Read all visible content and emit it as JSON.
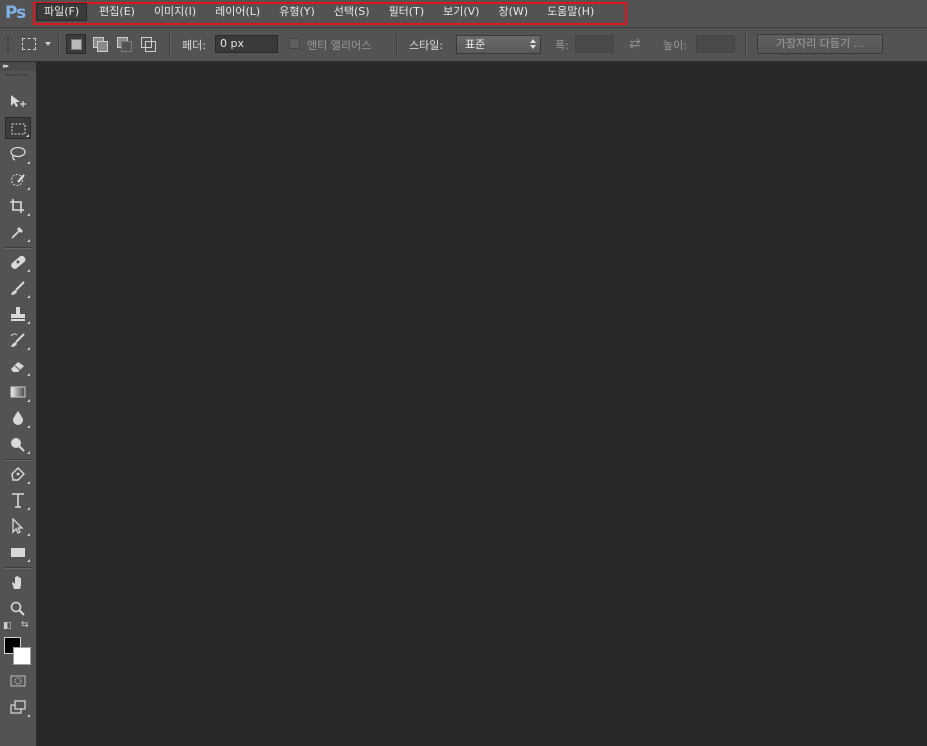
{
  "app": {
    "logo_text": "Ps"
  },
  "menu": {
    "items": [
      {
        "label": "파일(F)",
        "active": true
      },
      {
        "label": "편집(E)"
      },
      {
        "label": "이미지(I)"
      },
      {
        "label": "레이어(L)"
      },
      {
        "label": "유형(Y)"
      },
      {
        "label": "선택(S)"
      },
      {
        "label": "필터(T)"
      },
      {
        "label": "보기(V)"
      },
      {
        "label": "창(W)"
      },
      {
        "label": "도움말(H)"
      }
    ],
    "highlight_color": "#e0141c"
  },
  "options": {
    "feather_label": "페더:",
    "feather_value": "0 px",
    "antialias_label": "앤티 앨리어스",
    "style_label": "스타일:",
    "style_value": "표준",
    "width_label": "폭:",
    "height_label": "높이:",
    "refine_edge_label": "가장자리 다듬기 ..."
  },
  "toolbox": {
    "collapse_glyph": "▸▸",
    "selected_tool": "rectangular-marquee",
    "tools": [
      "move",
      "rectangular-marquee",
      "lasso",
      "quick-selection",
      "crop",
      "eyedropper",
      "spot-healing-brush",
      "brush",
      "clone-stamp",
      "history-brush",
      "eraser",
      "gradient",
      "blur",
      "dodge",
      "pen",
      "type",
      "path-selection",
      "rectangle",
      "hand",
      "zoom"
    ],
    "foreground_color": "#000000",
    "background_color": "#ffffff"
  }
}
